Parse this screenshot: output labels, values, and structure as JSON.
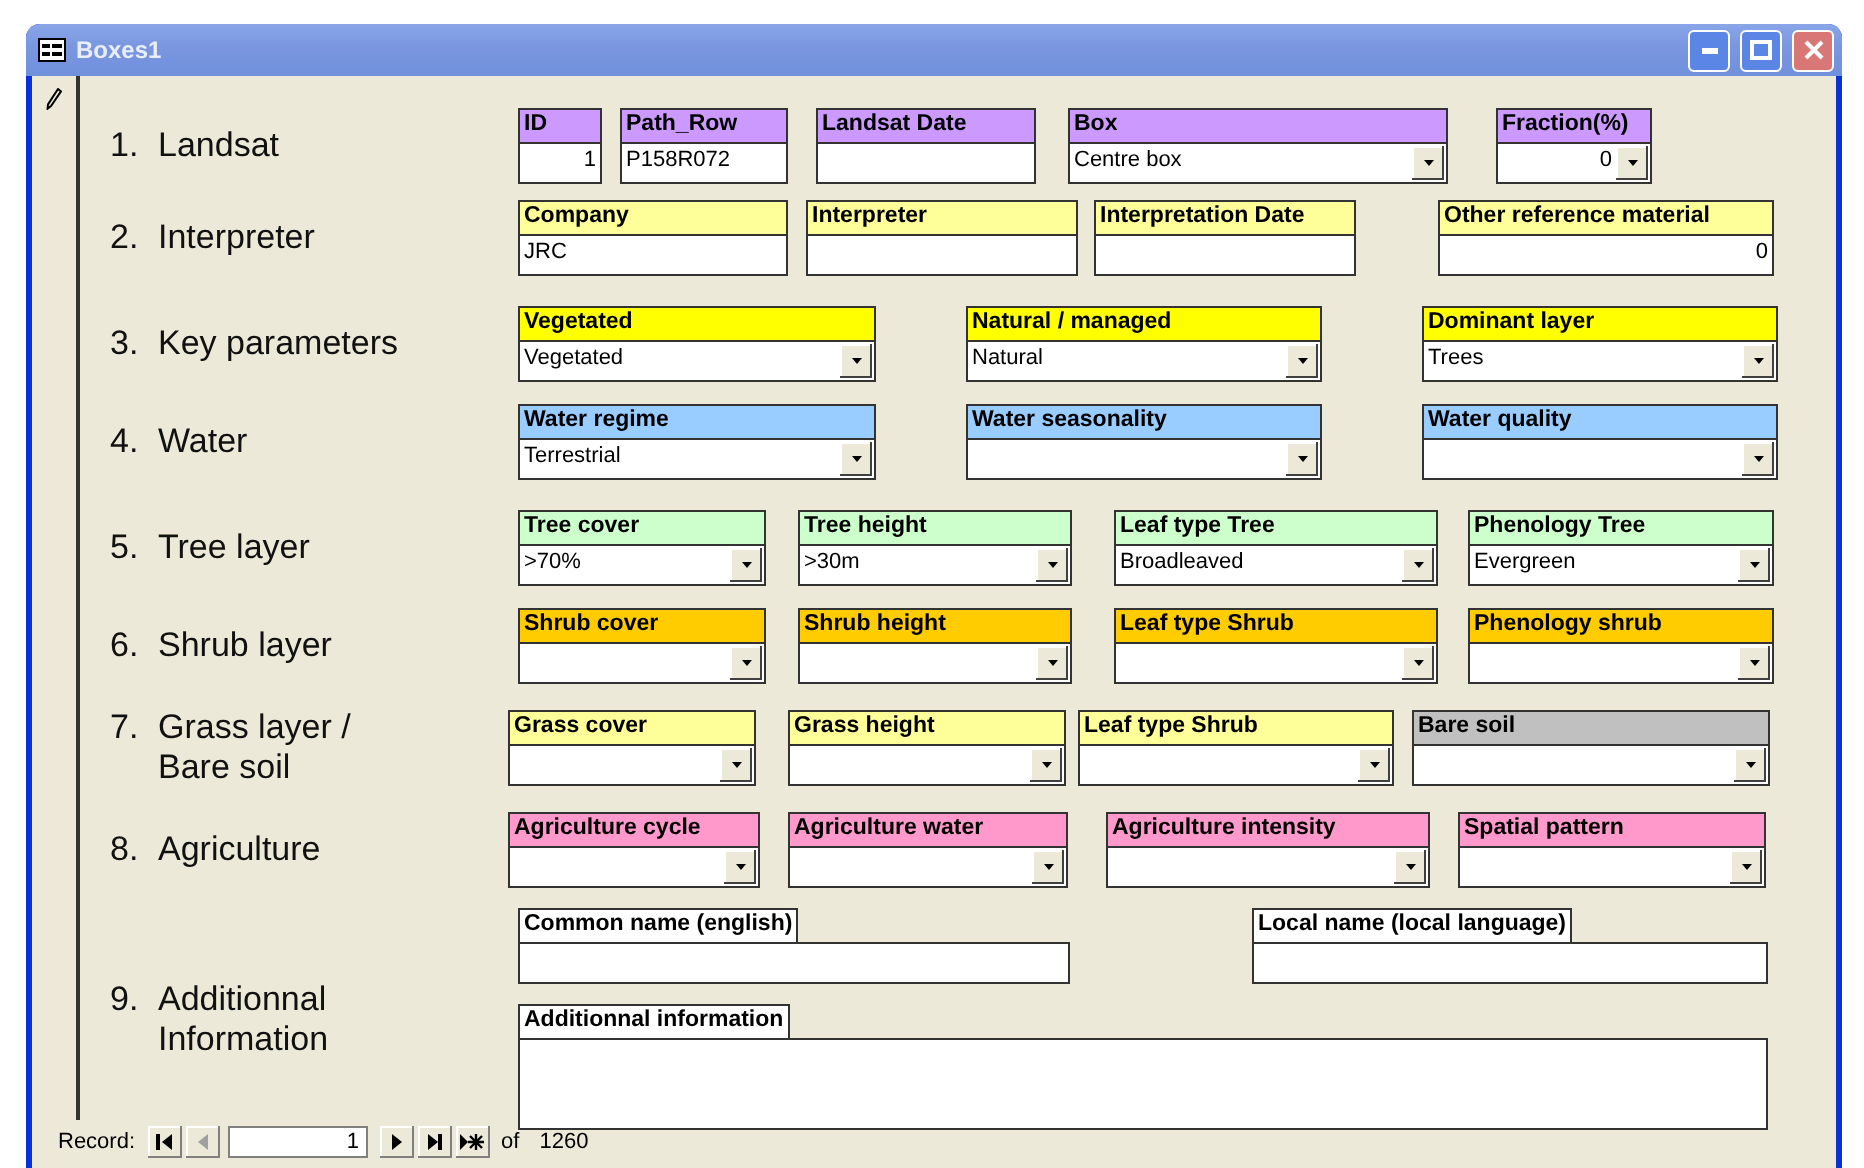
{
  "window": {
    "title": "Boxes1"
  },
  "sections": [
    {
      "number": "1.",
      "title": "Landsat",
      "fields": [
        {
          "label": "ID",
          "kind": "text",
          "color": "#cc99ff",
          "value": "1",
          "right_aligned": true
        },
        {
          "label": "Path_Row",
          "kind": "text",
          "color": "#cc99ff",
          "value": "P158R072"
        },
        {
          "label": "Landsat Date",
          "kind": "text",
          "color": "#cc99ff"
        },
        {
          "label": "Box",
          "kind": "combo",
          "color": "#cc99ff",
          "value": "Centre box"
        },
        {
          "label": "Fraction(%)",
          "kind": "combo",
          "color": "#cc99ff",
          "value": "0",
          "right_aligned": true
        }
      ]
    },
    {
      "number": "2.",
      "title": "Interpreter",
      "fields": [
        {
          "label": "Company",
          "kind": "text",
          "color": "#ffff99",
          "value": "JRC"
        },
        {
          "label": "Interpreter",
          "kind": "text",
          "color": "#ffff99"
        },
        {
          "label": "Interpretation Date",
          "kind": "text",
          "color": "#ffff99"
        },
        {
          "label": "Other reference material",
          "kind": "text",
          "color": "#ffff99",
          "value": "0",
          "right_aligned": true
        }
      ]
    },
    {
      "number": "3.",
      "title": "Key parameters",
      "fields": [
        {
          "label": "Vegetated",
          "kind": "combo",
          "color": "#ffff00",
          "value": "Vegetated"
        },
        {
          "label": "Natural / managed",
          "kind": "combo",
          "color": "#ffff00",
          "value": "Natural"
        },
        {
          "label": "Dominant layer",
          "kind": "combo",
          "color": "#ffff00",
          "value": "Trees"
        }
      ]
    },
    {
      "number": "4.",
      "title": "Water",
      "fields": [
        {
          "label": "Water regime",
          "kind": "combo",
          "color": "#99ccff",
          "value": "Terrestrial"
        },
        {
          "label": "Water seasonality",
          "kind": "combo",
          "color": "#99ccff"
        },
        {
          "label": "Water quality",
          "kind": "combo",
          "color": "#99ccff"
        }
      ]
    },
    {
      "number": "5.",
      "title": "Tree layer",
      "fields": [
        {
          "label": "Tree cover",
          "kind": "combo",
          "color": "#ccffcc",
          "value": ">70%"
        },
        {
          "label": "Tree height",
          "kind": "combo",
          "color": "#ccffcc",
          "value": ">30m"
        },
        {
          "label": "Leaf type Tree",
          "kind": "combo",
          "color": "#ccffcc",
          "value": "Broadleaved"
        },
        {
          "label": "Phenology Tree",
          "kind": "combo",
          "color": "#ccffcc",
          "value": "Evergreen"
        }
      ]
    },
    {
      "number": "6.",
      "title": "Shrub layer",
      "fields": [
        {
          "label": "Shrub cover",
          "kind": "combo",
          "color": "#ffcc00"
        },
        {
          "label": "Shrub height",
          "kind": "combo",
          "color": "#ffcc00"
        },
        {
          "label": "Leaf type Shrub",
          "kind": "combo",
          "color": "#ffcc00"
        },
        {
          "label": "Phenology shrub",
          "kind": "combo",
          "color": "#ffcc00"
        }
      ]
    },
    {
      "number": "7.",
      "title": "Grass layer / Bare soil",
      "fields": [
        {
          "label": "Grass cover",
          "kind": "combo",
          "color": "#ffff99"
        },
        {
          "label": "Grass height",
          "kind": "combo",
          "color": "#ffff99"
        },
        {
          "label": "Leaf type Shrub",
          "kind": "combo",
          "color": "#ffff99"
        },
        {
          "label": "Bare soil",
          "kind": "combo",
          "color": "#c0c0c0"
        }
      ]
    },
    {
      "number": "8.",
      "title": "Agriculture",
      "fields": [
        {
          "label": "Agriculture cycle",
          "kind": "combo",
          "color": "#ff99cc"
        },
        {
          "label": "Agriculture water",
          "kind": "combo",
          "color": "#ff99cc"
        },
        {
          "label": "Agriculture intensity",
          "kind": "combo",
          "color": "#ff99cc"
        },
        {
          "label": "Spatial pattern",
          "kind": "combo",
          "color": "#ff99cc"
        }
      ]
    },
    {
      "number": "9.",
      "title": "Additionnal Information",
      "fields": [
        {
          "label": "Common name (english)",
          "kind": "text"
        },
        {
          "label": "Local name (local language)",
          "kind": "text"
        },
        {
          "label": "Additionnal information",
          "kind": "memo"
        }
      ]
    }
  ],
  "navigator": {
    "label": "Record:",
    "current": "1",
    "of": "of",
    "total": "1260",
    "buttons": [
      {
        "kind": "first",
        "disabled": false
      },
      {
        "kind": "previous",
        "disabled": true
      },
      {
        "kind": "next",
        "disabled": false
      },
      {
        "kind": "last",
        "disabled": false
      },
      {
        "kind": "new",
        "disabled": false
      }
    ]
  }
}
